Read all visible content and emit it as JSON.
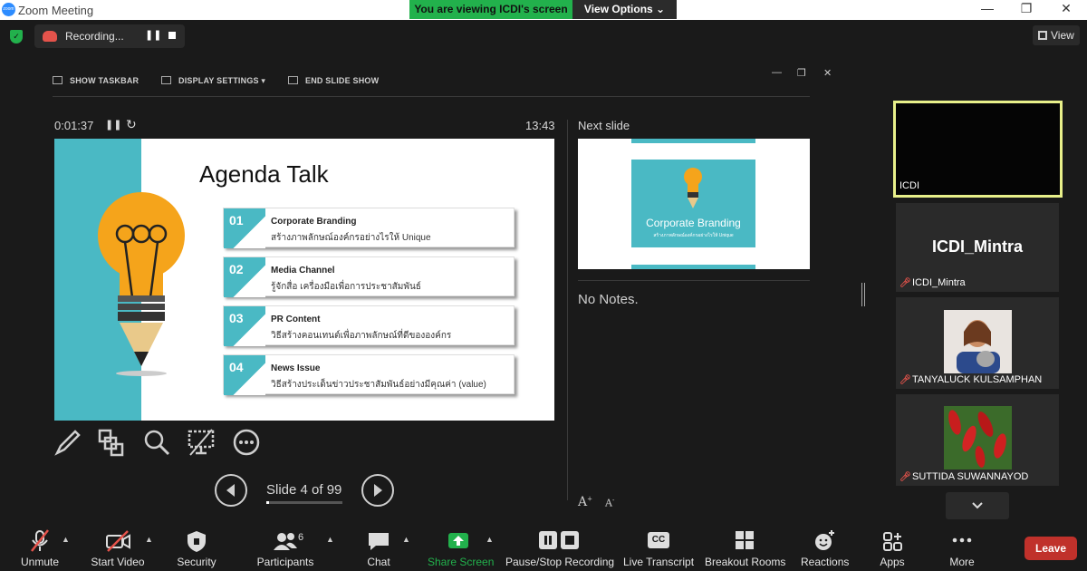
{
  "window": {
    "title": "Zoom Meeting",
    "logo_text": "zoom",
    "minimize": "—",
    "restore": "❐",
    "close": "✕"
  },
  "banner": {
    "viewing": "You are viewing ICDI's screen",
    "view_options": "View Options ⌄"
  },
  "recording": {
    "label": "Recording...",
    "pause": "❚❚"
  },
  "view_button": "View",
  "presenter": {
    "toolbar": [
      "SHOW TASKBAR",
      "DISPLAY SETTINGS ▾",
      "END SLIDE SHOW"
    ],
    "timer": "0:01:37",
    "timer_pause": "❚❚",
    "timer_reset": "↻",
    "clock": "13:43",
    "next_slide_label": "Next slide",
    "notes": "No Notes.",
    "font_larger": "A",
    "font_smaller": "A",
    "slide_counter": "Slide 4 of 99",
    "slide_progress": 0.04
  },
  "slide": {
    "title": "Agenda Talk",
    "items": [
      {
        "num": "01",
        "head": "Corporate Branding",
        "sub": "สร้างภาพลักษณ์องค์กรอย่างไรให้ Unique"
      },
      {
        "num": "02",
        "head": "Media Channel",
        "sub": "รู้จักสื่อ เครื่องมือเพื่อการประชาสัมพันธ์"
      },
      {
        "num": "03",
        "head": "PR Content",
        "sub": "วิธีสร้างคอนเทนต์เพื่อภาพลักษณ์ที่ดีขององค์กร"
      },
      {
        "num": "04",
        "head": "News Issue",
        "sub": "วิธีสร้างประเด็นข่าวประชาสัมพันธ์อย่างมีคุณค่า (value)"
      }
    ]
  },
  "next_slide": {
    "title": "Corporate Branding",
    "sub": "สร้างภาพลักษณ์องค์กรอย่างไรให้ Unique"
  },
  "participants": [
    {
      "name": "ICDI",
      "muted": false,
      "active": true
    },
    {
      "name": "ICDI_Mintra",
      "bigname": "ICDI_Mintra",
      "muted": true
    },
    {
      "name": "TANYALUCK KULSAMPHAN",
      "muted": true
    },
    {
      "name": "SUTTIDA SUWANNAYOD",
      "muted": true
    }
  ],
  "toolbar": {
    "unmute": "Unmute",
    "start_video": "Start Video",
    "security": "Security",
    "participants": "Participants",
    "participants_count": "6",
    "chat": "Chat",
    "share_screen": "Share Screen",
    "pause_stop": "Pause/Stop Recording",
    "live_transcript": "Live Transcript",
    "cc": "CC",
    "breakout": "Breakout Rooms",
    "reactions": "Reactions",
    "apps": "Apps",
    "more": "More",
    "leave": "Leave"
  },
  "colors": {
    "accent_green": "#22b14c",
    "slide_teal": "#4ab9c4",
    "leave_red": "#c0312b",
    "active_border": "#e8f08a"
  }
}
